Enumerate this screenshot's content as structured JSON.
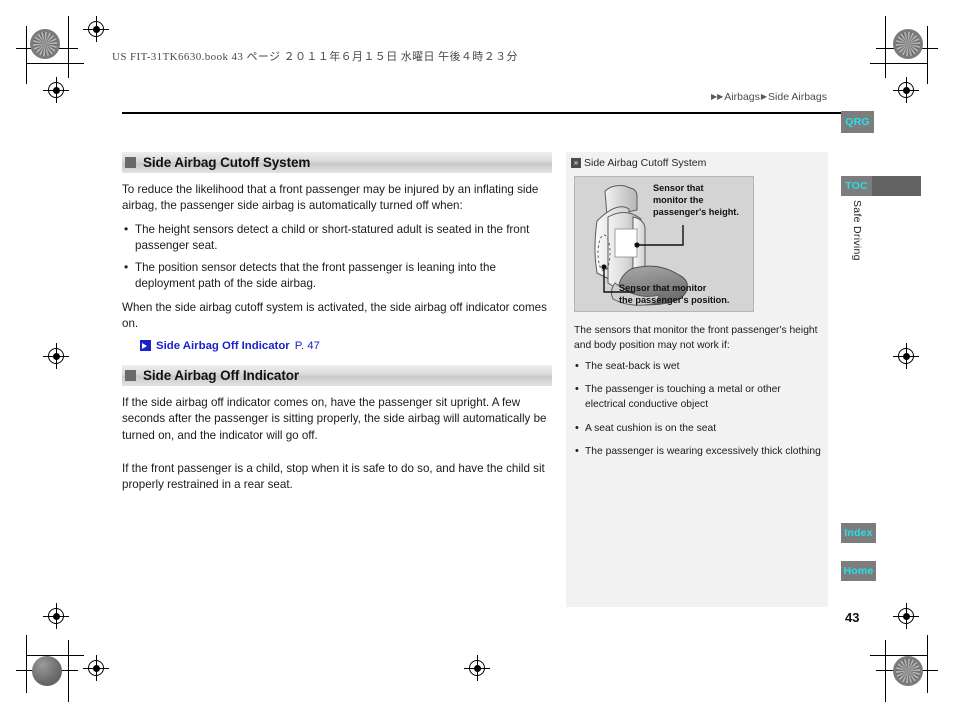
{
  "print_info": "US FIT-31TK6630.book   43 ページ   ２０１１年６月１５日   水曜日   午後４時２３分",
  "breadcrumb": {
    "arrow_double": "▶▶",
    "level1": "Airbags",
    "arrow_single": "▶",
    "level2": "Side Airbags"
  },
  "left_column": {
    "section1": {
      "heading": "Side Airbag Cutoff System",
      "intro": "To reduce the likelihood that a front passenger may be injured by an inflating side airbag, the passenger side airbag is automatically turned off when:",
      "bullets": [
        "The height sensors detect a child or short-statured adult is seated in the front passenger seat.",
        "The position sensor detects that the front passenger is leaning into the deployment path of the side airbag."
      ],
      "closing": "When the side airbag cutoff system is activated, the side airbag off indicator comes on.",
      "xref_label": "Side Airbag Off Indicator",
      "xref_page": "P. 47"
    },
    "section2": {
      "heading": "Side Airbag Off Indicator",
      "paragraphs": [
        "If the side airbag off indicator comes on, have the passenger sit upright. A few seconds after the passenger is sitting properly, the side airbag will automatically be turned on, and the indicator will go off.",
        "If the front passenger is a child, stop when it is safe to do so, and have the child sit properly restrained in a rear seat."
      ]
    }
  },
  "side_panel": {
    "marker": "»",
    "heading": "Side Airbag Cutoff System",
    "figure": {
      "callout_top": "Sensor that\nmonitor the\npassenger's height.",
      "callout_top_line1": "Sensor that",
      "callout_top_line2": "monitor the",
      "callout_top_line3": "passenger's height.",
      "callout_bottom_line1": "Sensor that monitor",
      "callout_bottom_line2": "the passenger's position."
    },
    "intro": "The sensors that monitor the front passenger's height and body position may not work if:",
    "bullets": [
      "The seat-back is wet",
      "The passenger is touching a metal or other electrical conductive object",
      "A seat cushion is on the seat",
      "The passenger is wearing excessively thick clothing"
    ]
  },
  "tabs": {
    "qrg": "QRG",
    "toc": "TOC",
    "section_label": "Safe Driving",
    "index": "Index",
    "home": "Home"
  },
  "page_number": "43",
  "colors": {
    "tab_bg": "#7d7d7d",
    "tab_text": "#25e0e8",
    "link": "#1a22c8",
    "panel_bg": "#f2f2f2",
    "figure_bg": "#d4d4d4"
  }
}
